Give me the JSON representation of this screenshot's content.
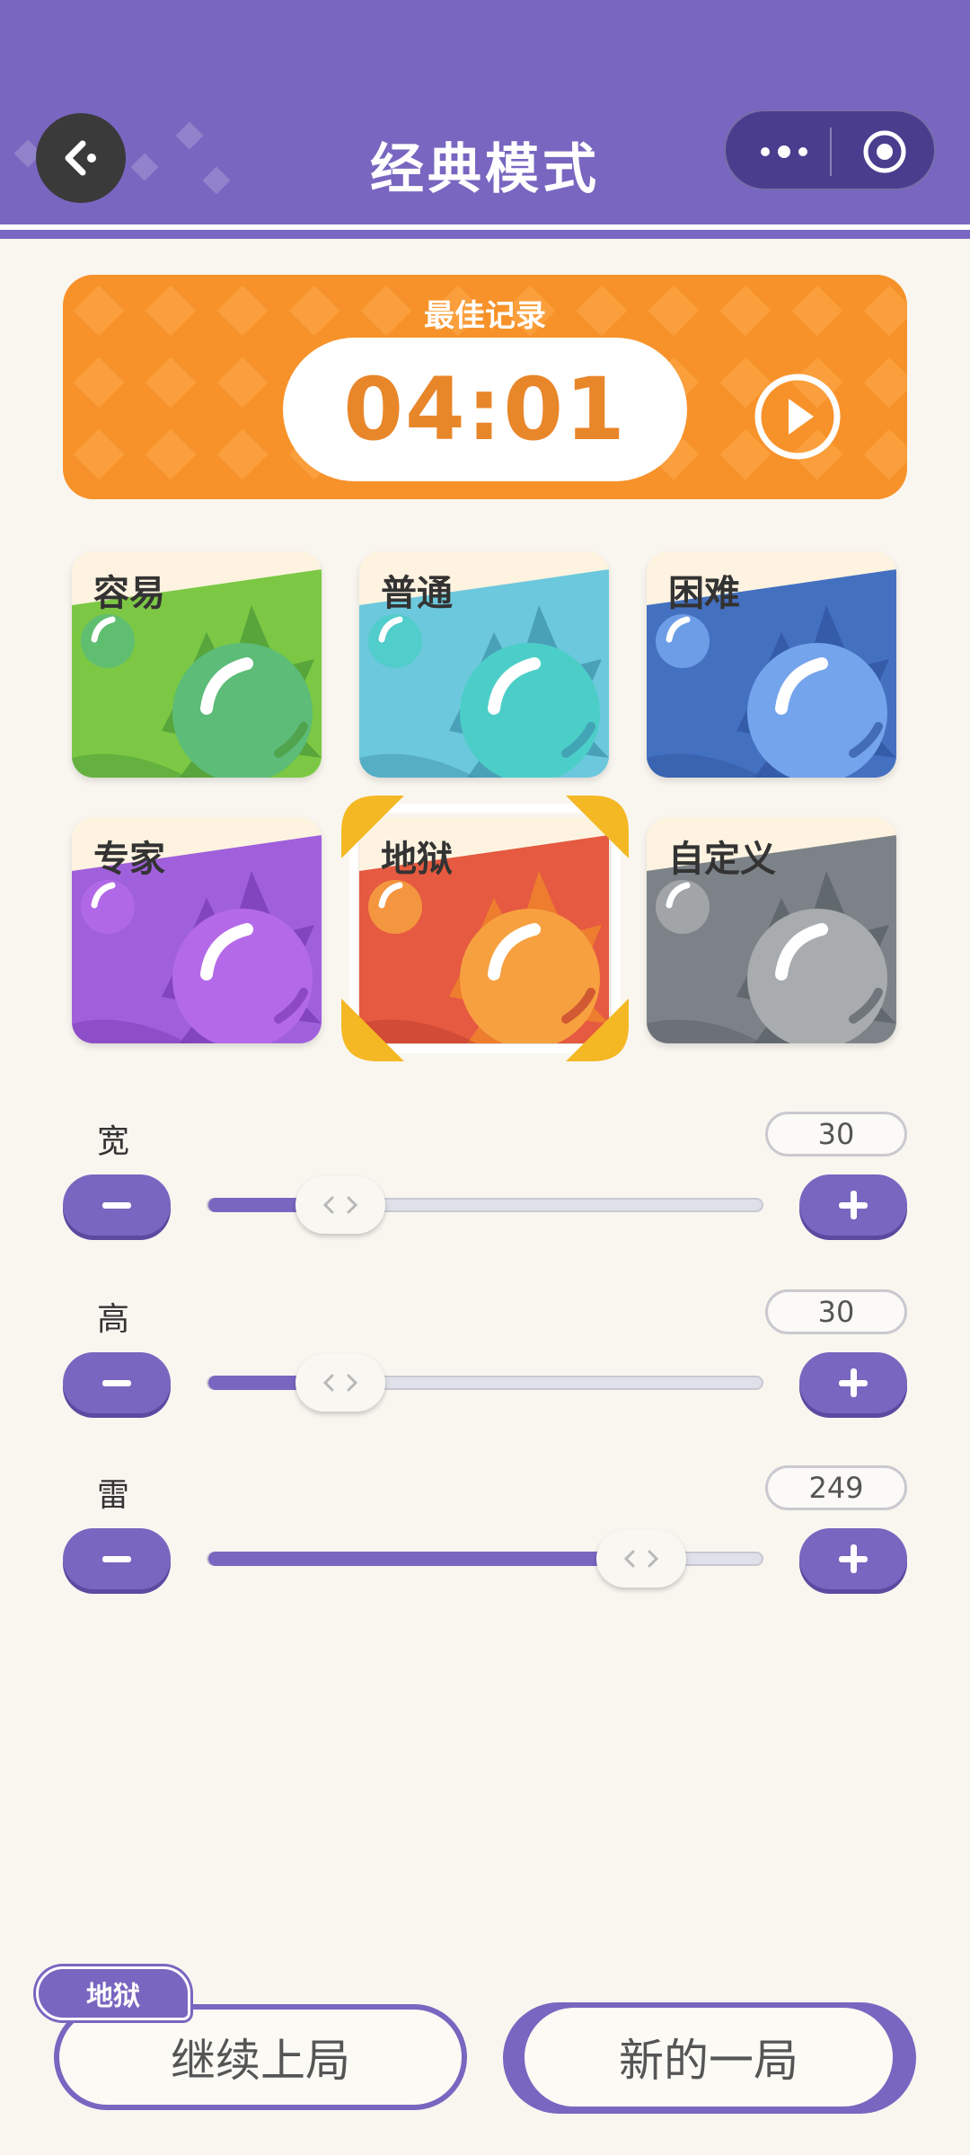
{
  "header": {
    "title": "经典模式",
    "back_icon": "back-arrow-icon",
    "menu_icon": "more-dots-icon",
    "close_icon": "target-circle-icon"
  },
  "record": {
    "label": "最佳记录",
    "time": "04:01",
    "play_icon": "play-icon"
  },
  "difficulties": [
    {
      "label": "容易",
      "color": "#7cc844"
    },
    {
      "label": "普通",
      "color": "#6cc8dc"
    },
    {
      "label": "困难",
      "color": "#4470c0"
    },
    {
      "label": "专家",
      "color": "#a060dc"
    },
    {
      "label": "地狱",
      "color": "#e55a40",
      "selected": true
    },
    {
      "label": "自定义",
      "color": "#7c8288"
    }
  ],
  "sliders": [
    {
      "label": "宽",
      "value": "30",
      "fill_fraction": 0.24
    },
    {
      "label": "高",
      "value": "30",
      "fill_fraction": 0.24
    },
    {
      "label": "雷",
      "value": "249",
      "fill_fraction": 0.78
    }
  ],
  "actions": {
    "mode_badge": "地狱",
    "continue_label": "继续上局",
    "new_label": "新的一局"
  },
  "colors": {
    "accent": "#7866c0",
    "record_orange": "#f7922a",
    "background": "#f9f6f0"
  }
}
